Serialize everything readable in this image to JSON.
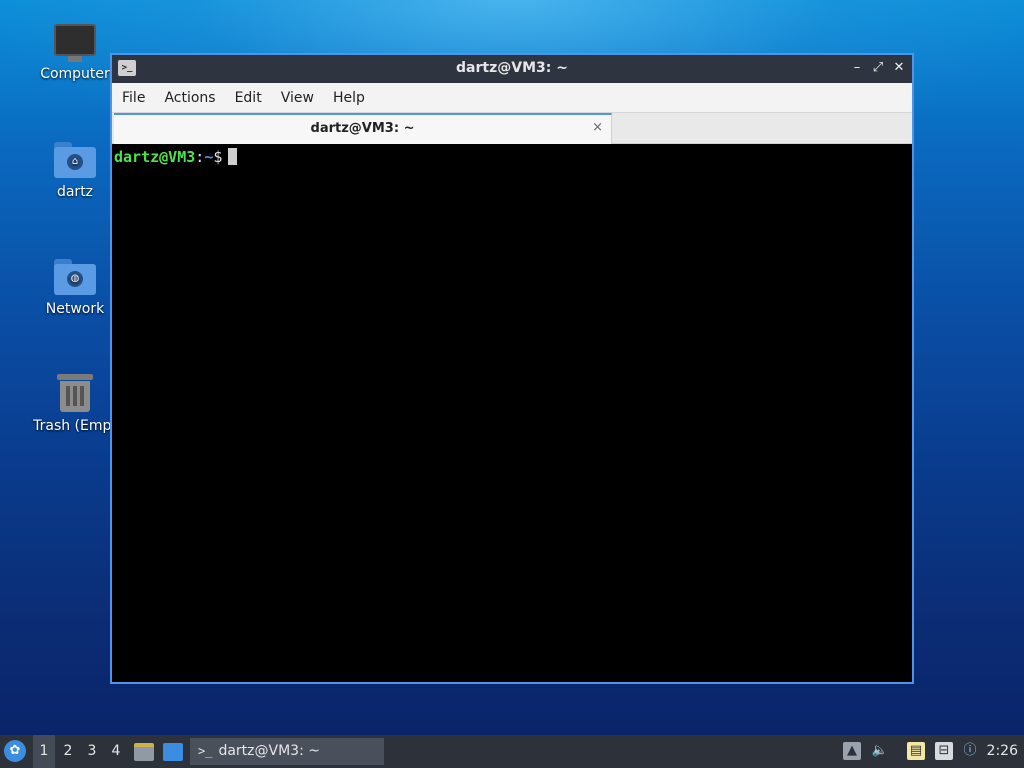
{
  "desktop": {
    "icons": [
      {
        "label": "Computer",
        "icon": "computer-icon"
      },
      {
        "label": "dartz",
        "icon": "home-folder-icon"
      },
      {
        "label": "Network",
        "icon": "network-folder-icon"
      },
      {
        "label": "Trash (Empt",
        "icon": "trash-icon"
      }
    ]
  },
  "window": {
    "title": "dartz@VM3: ~",
    "menu": [
      "File",
      "Actions",
      "Edit",
      "View",
      "Help"
    ],
    "tab": {
      "label": "dartz@VM3: ~",
      "close": "×"
    },
    "terminal": {
      "user_host": "dartz@VM3",
      "colon": ":",
      "path": "~",
      "symbol": "$"
    },
    "colors": {
      "prompt_user": "#4ee24e",
      "prompt_path": "#5a8cf0",
      "border_accent": "#4f94e8"
    }
  },
  "taskbar": {
    "workspaces": [
      "1",
      "2",
      "3",
      "4"
    ],
    "active_workspace": "1",
    "task_label": "dartz@VM3: ~",
    "clock": "2:26",
    "tray_icons": [
      "eject-icon",
      "volume-icon",
      "clipboard-icon",
      "network-wired-icon",
      "update-notifier-icon"
    ]
  }
}
